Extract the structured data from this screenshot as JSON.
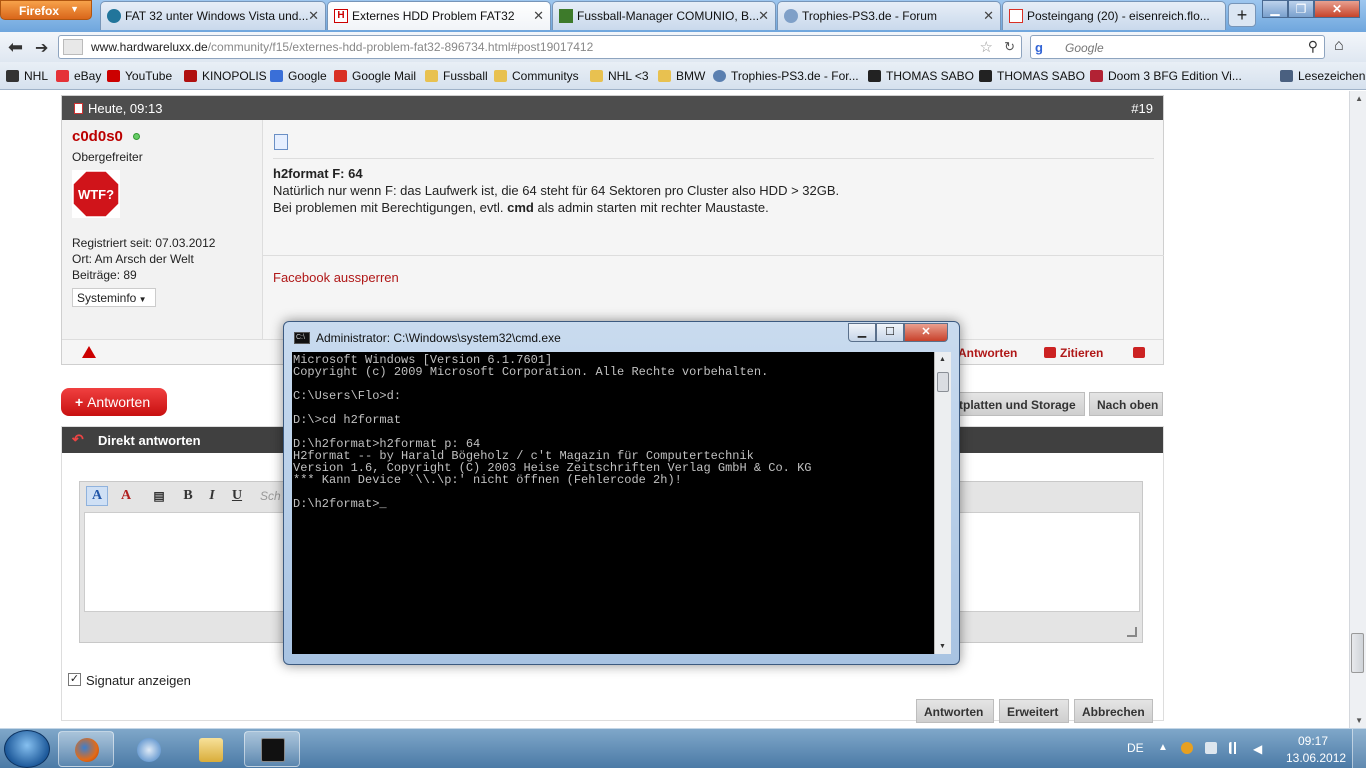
{
  "browser": {
    "menu_button": "Firefox",
    "tabs": [
      {
        "label": "FAT 32 unter Windows Vista und...",
        "active": false
      },
      {
        "label": "Externes HDD Problem FAT32",
        "active": true
      },
      {
        "label": "Fussball-Manager COMUNIO, B...",
        "active": false
      },
      {
        "label": "Trophies-PS3.de - Forum",
        "active": false
      },
      {
        "label": "Posteingang (20) - eisenreich.flo...",
        "active": false
      }
    ],
    "url_domain": "www.hardwareluxx.de",
    "url_path": "/community/f15/externes-hdd-problem-fat32-896734.html#post19017412",
    "search_engine": "g",
    "search_placeholder": "Google",
    "bookmarks": [
      {
        "label": "NHL",
        "color": "#333333"
      },
      {
        "label": "eBay",
        "color": "#e53238"
      },
      {
        "label": "YouTube",
        "color": "#cc0000"
      },
      {
        "label": "KINOPOLIS",
        "color": "#b01010"
      },
      {
        "label": "Google",
        "color": "#3a6fd8"
      },
      {
        "label": "Google Mail",
        "color": "#d93025"
      },
      {
        "label": "Fussball",
        "color": "#e8c150"
      },
      {
        "label": "Communitys",
        "color": "#e8c150"
      },
      {
        "label": "NHL <3",
        "color": "#e8c150"
      },
      {
        "label": "BMW",
        "color": "#e8c150"
      },
      {
        "label": "Trophies-PS3.de - For...",
        "color": "#5a7fb0"
      },
      {
        "label": "THOMAS SABO",
        "color": "#222222"
      },
      {
        "label": "THOMAS SABO",
        "color": "#222222"
      },
      {
        "label": "Doom 3 BFG Edition Vi...",
        "color": "#b22234"
      }
    ],
    "bookmarks_menu": "Lesezeichen"
  },
  "post": {
    "time": "Heute, 09:13",
    "number": "#19",
    "user": {
      "name": "c0d0s0",
      "rank": "Obergefreiter",
      "avatar_text": "WTF?",
      "registered": "Registriert seit: 07.03.2012",
      "location": "Ort: Am Arsch der Welt",
      "posts": "Beiträge: 89",
      "sysinfo_label": "Systeminfo"
    },
    "title": "h2format F: 64",
    "line1": "Natürlich nur wenn F: das Laufwerk ist, die 64 steht für 64 Sektoren pro Cluster also HDD > 32GB.",
    "line2_pre": "Bei problemen mit Berechtigungen, evtl. ",
    "line2_bold": "cmd",
    "line2_post": " als admin starten mit rechter Maustaste.",
    "signature_link": "Facebook aussperren",
    "actions": {
      "reply_quote": "Antworten",
      "quote": "Zitieren"
    }
  },
  "page_buttons": {
    "reply": "Antworten",
    "forum": "tplatten und Storage",
    "top": "Nach oben"
  },
  "quick_reply": {
    "title": "Direkt antworten",
    "font_partial": "Sch",
    "signature_label": "Signatur anzeigen",
    "buttons": [
      "Antworten",
      "Erweitert",
      "Abbrechen"
    ]
  },
  "cmd": {
    "title": "Administrator: C:\\Windows\\system32\\cmd.exe",
    "lines": [
      "Microsoft Windows [Version 6.1.7601]",
      "Copyright (c) 2009 Microsoft Corporation. Alle Rechte vorbehalten.",
      "",
      "C:\\Users\\Flo>d:",
      "",
      "D:\\>cd h2format",
      "",
      "D:\\h2format>h2format p: 64",
      "H2format -- by Harald Bögeholz / c't Magazin für Computertechnik",
      "Version 1.6, Copyright (C) 2003 Heise Zeitschriften Verlag GmbH & Co. KG",
      "*** Kann Device `\\\\.\\p:' nicht öffnen (Fehlercode 2h)!",
      "",
      "D:\\h2format>_"
    ]
  },
  "taskbar": {
    "language": "DE",
    "time": "09:17",
    "date": "13.06.2012"
  }
}
